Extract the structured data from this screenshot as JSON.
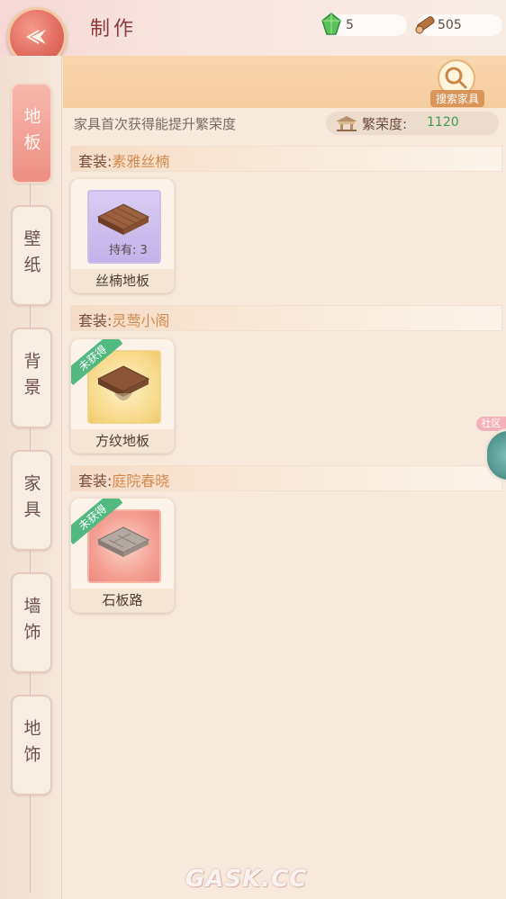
{
  "header": {
    "title": "制作",
    "resources": [
      {
        "icon": "green-gem-icon",
        "value": "5"
      },
      {
        "icon": "wood-log-icon",
        "value": "505"
      }
    ]
  },
  "tabs": [
    {
      "label": "地板",
      "active": true
    },
    {
      "label": "壁纸",
      "active": false
    },
    {
      "label": "背景",
      "active": false
    },
    {
      "label": "家具",
      "active": false
    },
    {
      "label": "墙饰",
      "active": false
    },
    {
      "label": "地饰",
      "active": false
    }
  ],
  "toolbar": {
    "search_label": "搜索家具"
  },
  "hint": "家具首次获得能提升繁荣度",
  "prosperity": {
    "label": "繁荣度:",
    "value": "1120"
  },
  "suits": [
    {
      "prefix": "套装:",
      "name": "素雅丝楠",
      "item": {
        "name": "丝楠地板",
        "owned": "持有: 3",
        "badge": ""
      }
    },
    {
      "prefix": "套装:",
      "name": "灵莺小阁",
      "item": {
        "name": "方纹地板",
        "owned": "",
        "badge": "未获得"
      }
    },
    {
      "prefix": "套装:",
      "name": "庭院春晓",
      "item": {
        "name": "石板路",
        "owned": "",
        "badge": "未获得"
      }
    }
  ],
  "side_float": {
    "label": "社区"
  },
  "watermark": "GASK.CC",
  "colors": {
    "accent": "#e06a5e",
    "gold": "#f5cd9f",
    "badge_green": "#52b981",
    "prosperity_value": "#3f9a54"
  }
}
